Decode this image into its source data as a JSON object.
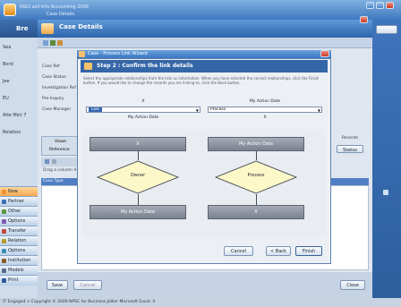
{
  "app": {
    "title_line1": "NSIU sell Info Accounting 2009",
    "title_line2": "Case Details",
    "nav_header": "Bre"
  },
  "left_nav": {
    "labels": [
      "Sea",
      "Bord",
      "Jee",
      "EU",
      "Atle Mini 7",
      "Relation"
    ],
    "bars": [
      {
        "label": "Now",
        "color": "#f0922e",
        "active": true
      },
      {
        "label": "Partner",
        "color": "#3a6fb5",
        "active": false
      },
      {
        "label": "Other",
        "color": "#5a9a3a",
        "active": false
      },
      {
        "label": "Options",
        "color": "#7c5cb0",
        "active": false
      },
      {
        "label": "Transfer",
        "color": "#c14a3a",
        "active": false
      },
      {
        "label": "Relation",
        "color": "#b59a2a",
        "active": false
      },
      {
        "label": "Options",
        "color": "#3a8fb0",
        "active": false
      },
      {
        "label": "Institution",
        "color": "#8a5a2a",
        "active": false
      },
      {
        "label": "Models",
        "color": "#5a6a8a",
        "active": false
      },
      {
        "label": "Print",
        "color": "#2a5a9a",
        "active": false
      }
    ]
  },
  "case_details": {
    "title": "Case Details",
    "fields": [
      "Case Ref",
      "Case Status",
      "Investigation Ref",
      "Pre-Inquiry",
      "Case Manager"
    ],
    "panel_left_title": "Views",
    "panel_left_sub": "Reference",
    "grid_caption": "Drag a column here",
    "grid_header": "Case Type",
    "right_labels": [
      "Records",
      "Status"
    ],
    "save_button": "Save",
    "cancel_button": "Cancel",
    "close_button": "Close"
  },
  "wizard": {
    "title": "Case - Process Link Wizard",
    "step_title": "Step 2 : Confirm the link details",
    "description": "Select the appropriate relationships from the lists as information. When you have selected the correct relationships, click the Finish button. If you would like to change the records you are linking to, click the Back button.",
    "left_column_header": "X",
    "right_column_header": "My Action Date",
    "left_select_value": "Low",
    "right_select_value": "Process",
    "left_sub_label": "My Action Date",
    "right_sub_label": "X",
    "left_top_box": "X",
    "right_top_box": "My Action Date",
    "left_diamond": "Owner",
    "right_diamond": "Process",
    "left_bottom_box": "My Action Date",
    "right_bottom_box": "X",
    "cancel_button": "Cancel",
    "back_button": "< Back",
    "finish_button": "Finish"
  },
  "status_bar": {
    "text": "IT Engaged >   Copyright © 2009 NPSC for Business.Jellier   Microsoft Excel: 4"
  }
}
